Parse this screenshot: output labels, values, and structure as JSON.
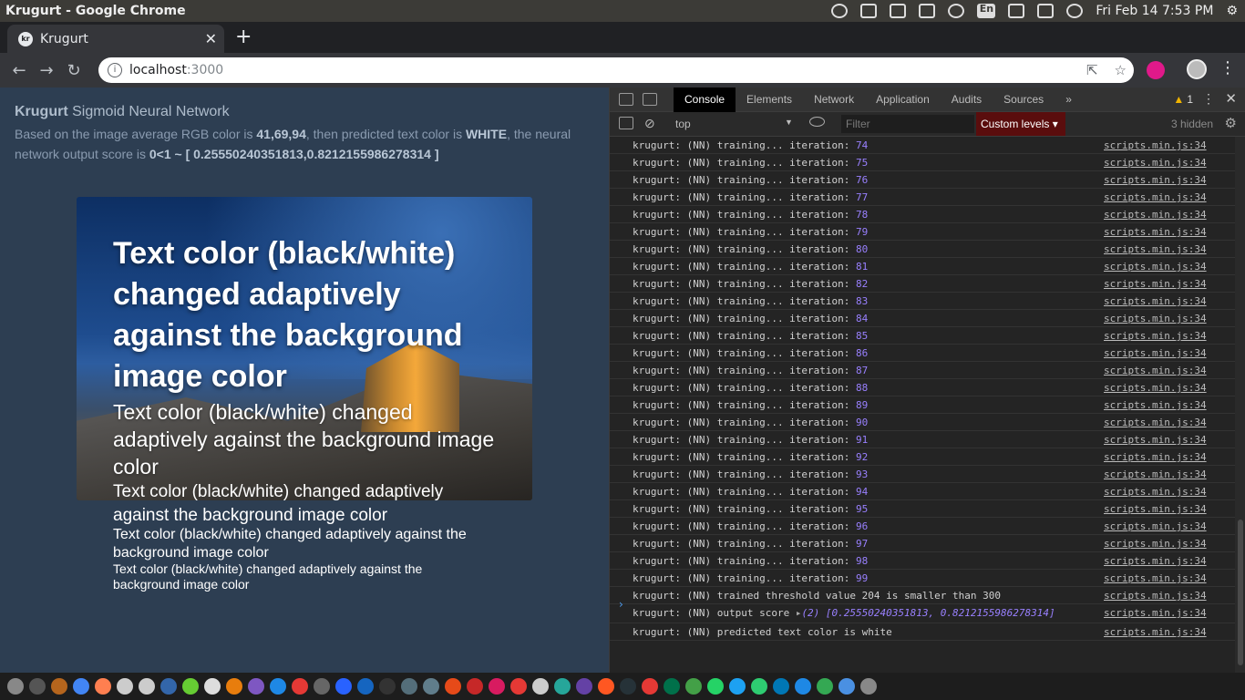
{
  "system": {
    "window_title": "Krugurt - Google Chrome",
    "lang": "En",
    "clock": "Fri Feb 14  7:53 PM"
  },
  "browser": {
    "tab_title": "Krugurt",
    "tab_favicon": "kr",
    "url_host": "localhost",
    "url_port": ":3000"
  },
  "page": {
    "heading_bold": "Krugurt",
    "heading_rest": " Sigmoid Neural Network",
    "desc_1": "Based on the image average RGB color is ",
    "rgb": "41,69,94",
    "desc_2": ", then predicted text color is ",
    "predicted": "WHITE",
    "desc_3": ", the neural network output score is ",
    "score": "0<1 ~ [ 0.25550240351813,0.8212155986278314 ]",
    "sample_text": "Text color (black/white) changed adaptively against the background image color"
  },
  "devtools": {
    "tabs": [
      "Console",
      "Elements",
      "Network",
      "Application",
      "Audits",
      "Sources"
    ],
    "warnings": "1",
    "context": "top",
    "filter_placeholder": "Filter",
    "levels": "Custom levels",
    "hidden": "3 hidden",
    "source": "scripts.min.js:34",
    "training_prefix": "krugurt: (NN) training... iteration: ",
    "iterations": [
      "74",
      "75",
      "76",
      "77",
      "78",
      "79",
      "80",
      "81",
      "82",
      "83",
      "84",
      "85",
      "86",
      "87",
      "88",
      "89",
      "90",
      "91",
      "92",
      "93",
      "94",
      "95",
      "96",
      "97",
      "98",
      "99"
    ],
    "threshold_msg": "krugurt: (NN) trained threshold value 204 is smaller than 300",
    "output_prefix": "krugurt: (NN) output score ",
    "output_array": "(2) [0.25550240351813, 0.8212155986278314]",
    "predicted_msg": "krugurt: (NN) predicted text color is white"
  },
  "colors": {
    "page_bg": "#2d3e52",
    "devtools_bg": "#242424",
    "levels_bg": "#5a0d0d",
    "console_number": "#9980ff"
  }
}
